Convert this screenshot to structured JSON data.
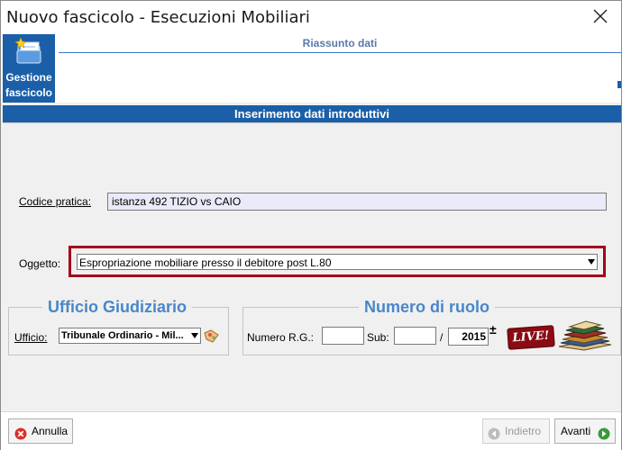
{
  "window": {
    "title": "Nuovo fascicolo - Esecuzioni Mobiliari"
  },
  "toolbar": {
    "gestione_line1": "Gestione",
    "gestione_line2": "fascicolo",
    "riassunto_label": "Riassunto dati"
  },
  "section": {
    "header": "Inserimento dati introduttivi"
  },
  "form": {
    "codice_label": "Codice pratica:",
    "codice_value": "istanza 492 TIZIO vs CAIO",
    "oggetto_label": "Oggetto:",
    "oggetto_value": "Espropriazione mobiliare presso il debitore post L.80"
  },
  "ufficio_box": {
    "title": "Ufficio Giudiziario",
    "ufficio_label": "Ufficio:",
    "ufficio_value": "Tribunale Ordinario - Mil..."
  },
  "ruolo_box": {
    "title": "Numero di ruolo",
    "rg_label": "Numero R.G.:",
    "rg_value": "",
    "sub_label": "Sub:",
    "sub_value": "",
    "slash": "/",
    "year_value": "2015",
    "live_label": "LIVE!"
  },
  "footer": {
    "annulla_label": "Annulla",
    "indietro_label": "Indietro",
    "avanti_label": "Avanti"
  },
  "colors": {
    "header_blue": "#1b5fa8",
    "highlight_red": "#a4001a",
    "box_title_blue": "#4a86c8"
  }
}
